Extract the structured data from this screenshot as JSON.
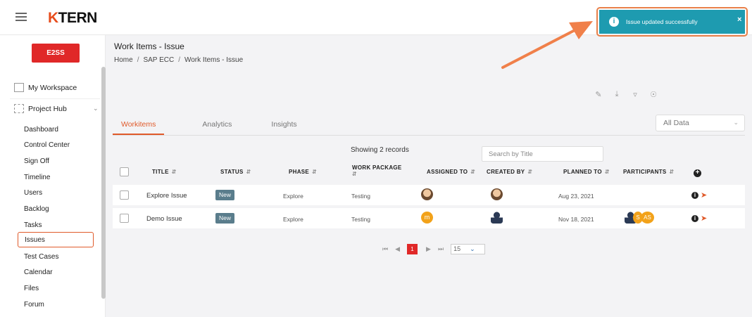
{
  "brand": {
    "logo_k": "K",
    "logo_rest": "TERN",
    "project_badge": "E2SS"
  },
  "sidebar": {
    "workspace_label": "My Workspace",
    "project_hub_label": "Project Hub",
    "items": [
      {
        "label": "Dashboard"
      },
      {
        "label": "Control Center"
      },
      {
        "label": "Sign Off"
      },
      {
        "label": "Timeline"
      },
      {
        "label": "Users"
      },
      {
        "label": "Backlog"
      },
      {
        "label": "Tasks"
      },
      {
        "label": "Issues",
        "active": true
      },
      {
        "label": "Test Cases"
      },
      {
        "label": "Calendar"
      },
      {
        "label": "Files"
      },
      {
        "label": "Forum"
      }
    ]
  },
  "page": {
    "title": "Work Items - Issue",
    "breadcrumb": [
      "Home",
      "SAP ECC",
      "Work Items - Issue"
    ]
  },
  "toolbar_icons": [
    "edit-icon",
    "download-icon",
    "filter-icon",
    "settings-icon"
  ],
  "tabs": [
    {
      "label": "Workitems",
      "active": true
    },
    {
      "label": "Analytics"
    },
    {
      "label": "Insights"
    }
  ],
  "filter": {
    "selected": "All Data"
  },
  "table": {
    "records_label": "Showing 2 records",
    "search_placeholder": "Search by Title",
    "columns": [
      "Title",
      "Status",
      "Phase",
      "Work Package",
      "Assigned To",
      "Created By",
      "Planned To",
      "Participants"
    ],
    "rows": [
      {
        "title": "Explore Issue",
        "status": "New",
        "phase": "Explore",
        "work_package": "Testing",
        "assigned_avatar": "",
        "created_avatar": "",
        "planned_to": "Aug 23, 2021",
        "participants": []
      },
      {
        "title": "Demo Issue",
        "status": "New",
        "phase": "Explore",
        "work_package": "Testing",
        "assigned_avatar": "m",
        "created_avatar": "",
        "planned_to": "Nov 18, 2021",
        "participants": [
          "S",
          "AS"
        ]
      }
    ]
  },
  "pagination": {
    "current_page": "1",
    "page_size": "15"
  },
  "toast": {
    "message": "Issue updated successfully",
    "close": "×",
    "info": "i"
  },
  "colors": {
    "accent": "#e05a2a",
    "brand_red": "#e02828",
    "toast_bg": "#1e9bb0",
    "status_badge": "#5a7d8c",
    "avatar_initial": "#f2a21a"
  }
}
